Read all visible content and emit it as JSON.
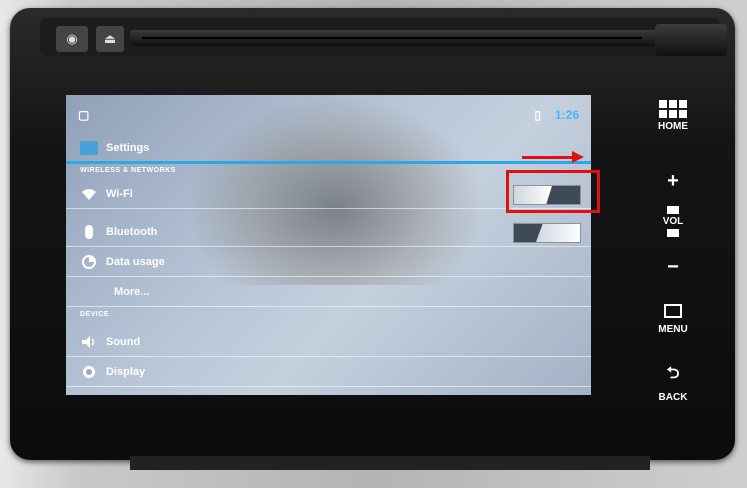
{
  "status_bar": {
    "left_icon": "▢",
    "right_icon": "▯",
    "time": "1:26"
  },
  "title": "Settings",
  "sections": [
    "WIRELESS & NETWORKS",
    "DEVICE"
  ],
  "items": [
    {
      "label": "Wi-Fi",
      "icon": "wifi-icon",
      "toggle": "off"
    },
    {
      "label": "Bluetooth",
      "icon": "bluetooth-icon",
      "toggle": "on"
    },
    {
      "label": "Data usage",
      "icon": "data-usage-icon"
    },
    {
      "label": "More..."
    },
    {
      "label": "Sound",
      "icon": "sound-icon"
    },
    {
      "label": "Display",
      "icon": "display-icon"
    }
  ],
  "hardware": {
    "home": "HOME",
    "plus": "+",
    "vol": "VOL",
    "minus": "−",
    "menu": "MENU",
    "back": "BACK"
  },
  "annotation_color": "#e01010",
  "accent_color": "#2aa9e8"
}
